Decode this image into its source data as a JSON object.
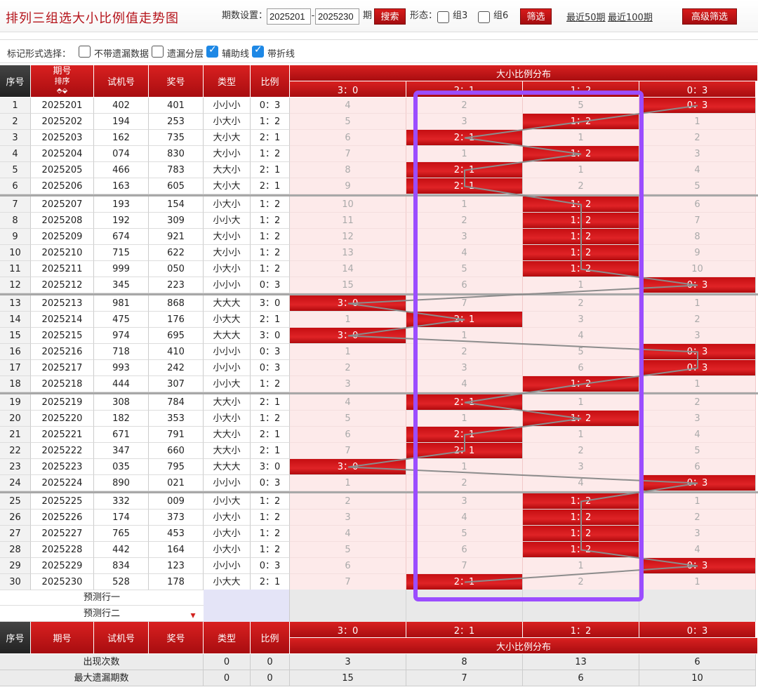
{
  "header": {
    "title": "排列三组选大小比例值走势图",
    "period_label": "期数设置：",
    "period_from": "2025201",
    "dash": "-",
    "period_to": "2025230",
    "period_unit": "期",
    "search_label": "搜索",
    "form_label": "形态：",
    "group3_label": "组3",
    "group6_label": "组6",
    "filter_label": "筛选",
    "recent50_label": "最近50期",
    "recent100_label": "最近100期",
    "advanced_label": "高级筛选"
  },
  "options": {
    "label": "标记形式选择：",
    "items": [
      {
        "label": "不带遗漏数据",
        "checked": false
      },
      {
        "label": "遗漏分层",
        "checked": false
      },
      {
        "label": "辅助线",
        "checked": true
      },
      {
        "label": "带折线",
        "checked": true
      }
    ]
  },
  "table": {
    "headers": {
      "seq": "序号",
      "period": "期号",
      "sort": "排序",
      "sort_icon": "sort-arrows-icon",
      "test": "试机号",
      "draw": "奖号",
      "type": "类型",
      "ratio": "比例",
      "dist": "大小比例分布"
    },
    "ratio_columns": [
      "3：0",
      "2：1",
      "1：2",
      "0：3"
    ],
    "rows": [
      {
        "seq": "1",
        "period": "2025201",
        "test": "402",
        "draw": "401",
        "type": "小小小",
        "ratio": "0：3",
        "dist": [
          "4",
          "2",
          "5",
          "0：3"
        ],
        "hit": 3
      },
      {
        "seq": "2",
        "period": "2025202",
        "test": "194",
        "draw": "253",
        "type": "小大小",
        "ratio": "1：2",
        "dist": [
          "5",
          "3",
          "1：2",
          "1"
        ],
        "hit": 2
      },
      {
        "seq": "3",
        "period": "2025203",
        "test": "162",
        "draw": "735",
        "type": "大小大",
        "ratio": "2：1",
        "dist": [
          "6",
          "2：1",
          "1",
          "2"
        ],
        "hit": 1
      },
      {
        "seq": "4",
        "period": "2025204",
        "test": "074",
        "draw": "830",
        "type": "大小小",
        "ratio": "1：2",
        "dist": [
          "7",
          "1",
          "1：2",
          "3"
        ],
        "hit": 2
      },
      {
        "seq": "5",
        "period": "2025205",
        "test": "466",
        "draw": "783",
        "type": "大大小",
        "ratio": "2：1",
        "dist": [
          "8",
          "2：1",
          "1",
          "4"
        ],
        "hit": 1
      },
      {
        "seq": "6",
        "period": "2025206",
        "test": "163",
        "draw": "605",
        "type": "大小大",
        "ratio": "2：1",
        "dist": [
          "9",
          "2：1",
          "2",
          "5"
        ],
        "hit": 1
      },
      {
        "seq": "7",
        "period": "2025207",
        "test": "193",
        "draw": "154",
        "type": "小大小",
        "ratio": "1：2",
        "dist": [
          "10",
          "1",
          "1：2",
          "6"
        ],
        "hit": 2
      },
      {
        "seq": "8",
        "period": "2025208",
        "test": "192",
        "draw": "309",
        "type": "小小大",
        "ratio": "1：2",
        "dist": [
          "11",
          "2",
          "1：2",
          "7"
        ],
        "hit": 2
      },
      {
        "seq": "9",
        "period": "2025209",
        "test": "674",
        "draw": "921",
        "type": "大小小",
        "ratio": "1：2",
        "dist": [
          "12",
          "3",
          "1：2",
          "8"
        ],
        "hit": 2
      },
      {
        "seq": "10",
        "period": "2025210",
        "test": "715",
        "draw": "622",
        "type": "大小小",
        "ratio": "1：2",
        "dist": [
          "13",
          "4",
          "1：2",
          "9"
        ],
        "hit": 2
      },
      {
        "seq": "11",
        "period": "2025211",
        "test": "999",
        "draw": "050",
        "type": "小大小",
        "ratio": "1：2",
        "dist": [
          "14",
          "5",
          "1：2",
          "10"
        ],
        "hit": 2
      },
      {
        "seq": "12",
        "period": "2025212",
        "test": "345",
        "draw": "223",
        "type": "小小小",
        "ratio": "0：3",
        "dist": [
          "15",
          "6",
          "1",
          "0：3"
        ],
        "hit": 3
      },
      {
        "seq": "13",
        "period": "2025213",
        "test": "981",
        "draw": "868",
        "type": "大大大",
        "ratio": "3：0",
        "dist": [
          "3：0",
          "7",
          "2",
          "1"
        ],
        "hit": 0
      },
      {
        "seq": "14",
        "period": "2025214",
        "test": "475",
        "draw": "176",
        "type": "小大大",
        "ratio": "2：1",
        "dist": [
          "1",
          "2：1",
          "3",
          "2"
        ],
        "hit": 1
      },
      {
        "seq": "15",
        "period": "2025215",
        "test": "974",
        "draw": "695",
        "type": "大大大",
        "ratio": "3：0",
        "dist": [
          "3：0",
          "1",
          "4",
          "3"
        ],
        "hit": 0
      },
      {
        "seq": "16",
        "period": "2025216",
        "test": "718",
        "draw": "410",
        "type": "小小小",
        "ratio": "0：3",
        "dist": [
          "1",
          "2",
          "5",
          "0：3"
        ],
        "hit": 3
      },
      {
        "seq": "17",
        "period": "2025217",
        "test": "993",
        "draw": "242",
        "type": "小小小",
        "ratio": "0：3",
        "dist": [
          "2",
          "3",
          "6",
          "0：3"
        ],
        "hit": 3
      },
      {
        "seq": "18",
        "period": "2025218",
        "test": "444",
        "draw": "307",
        "type": "小小大",
        "ratio": "1：2",
        "dist": [
          "3",
          "4",
          "1：2",
          "1"
        ],
        "hit": 2
      },
      {
        "seq": "19",
        "period": "2025219",
        "test": "308",
        "draw": "784",
        "type": "大大小",
        "ratio": "2：1",
        "dist": [
          "4",
          "2：1",
          "1",
          "2"
        ],
        "hit": 1
      },
      {
        "seq": "20",
        "period": "2025220",
        "test": "182",
        "draw": "353",
        "type": "小大小",
        "ratio": "1：2",
        "dist": [
          "5",
          "1",
          "1：2",
          "3"
        ],
        "hit": 2
      },
      {
        "seq": "21",
        "period": "2025221",
        "test": "671",
        "draw": "791",
        "type": "大大小",
        "ratio": "2：1",
        "dist": [
          "6",
          "2：1",
          "1",
          "4"
        ],
        "hit": 1
      },
      {
        "seq": "22",
        "period": "2025222",
        "test": "347",
        "draw": "660",
        "type": "大大小",
        "ratio": "2：1",
        "dist": [
          "7",
          "2：1",
          "2",
          "5"
        ],
        "hit": 1
      },
      {
        "seq": "23",
        "period": "2025223",
        "test": "035",
        "draw": "795",
        "type": "大大大",
        "ratio": "3：0",
        "dist": [
          "3：0",
          "1",
          "3",
          "6"
        ],
        "hit": 0
      },
      {
        "seq": "24",
        "period": "2025224",
        "test": "890",
        "draw": "021",
        "type": "小小小",
        "ratio": "0：3",
        "dist": [
          "1",
          "2",
          "4",
          "0：3"
        ],
        "hit": 3
      },
      {
        "seq": "25",
        "period": "2025225",
        "test": "332",
        "draw": "009",
        "type": "小小大",
        "ratio": "1：2",
        "dist": [
          "2",
          "3",
          "1：2",
          "1"
        ],
        "hit": 2
      },
      {
        "seq": "26",
        "period": "2025226",
        "test": "174",
        "draw": "373",
        "type": "小大小",
        "ratio": "1：2",
        "dist": [
          "3",
          "4",
          "1：2",
          "2"
        ],
        "hit": 2
      },
      {
        "seq": "27",
        "period": "2025227",
        "test": "765",
        "draw": "453",
        "type": "小大小",
        "ratio": "1：2",
        "dist": [
          "4",
          "5",
          "1：2",
          "3"
        ],
        "hit": 2
      },
      {
        "seq": "28",
        "period": "2025228",
        "test": "442",
        "draw": "164",
        "type": "小大小",
        "ratio": "1：2",
        "dist": [
          "5",
          "6",
          "1：2",
          "4"
        ],
        "hit": 2
      },
      {
        "seq": "29",
        "period": "2025229",
        "test": "834",
        "draw": "123",
        "type": "小小小",
        "ratio": "0：3",
        "dist": [
          "6",
          "7",
          "1",
          "0：3"
        ],
        "hit": 3
      },
      {
        "seq": "30",
        "period": "2025230",
        "test": "528",
        "draw": "178",
        "type": "小大大",
        "ratio": "2：1",
        "dist": [
          "7",
          "2：1",
          "2",
          "1"
        ],
        "hit": 1
      }
    ],
    "predict_rows": [
      "预测行一",
      "预测行二"
    ],
    "stats": [
      {
        "label": "出现次数",
        "type": "0",
        "ratio": "0",
        "values": [
          "3",
          "8",
          "13",
          "6"
        ]
      },
      {
        "label": "最大遗漏期数",
        "type": "0",
        "ratio": "0",
        "values": [
          "15",
          "7",
          "6",
          "10"
        ]
      }
    ]
  },
  "colors": {
    "header_red": "#c0141a",
    "hit_red": "#d0161a",
    "dist_bg": "#fdeaea",
    "highlight_box": "#9b4dff",
    "trend_line": "#8c8c8c"
  }
}
